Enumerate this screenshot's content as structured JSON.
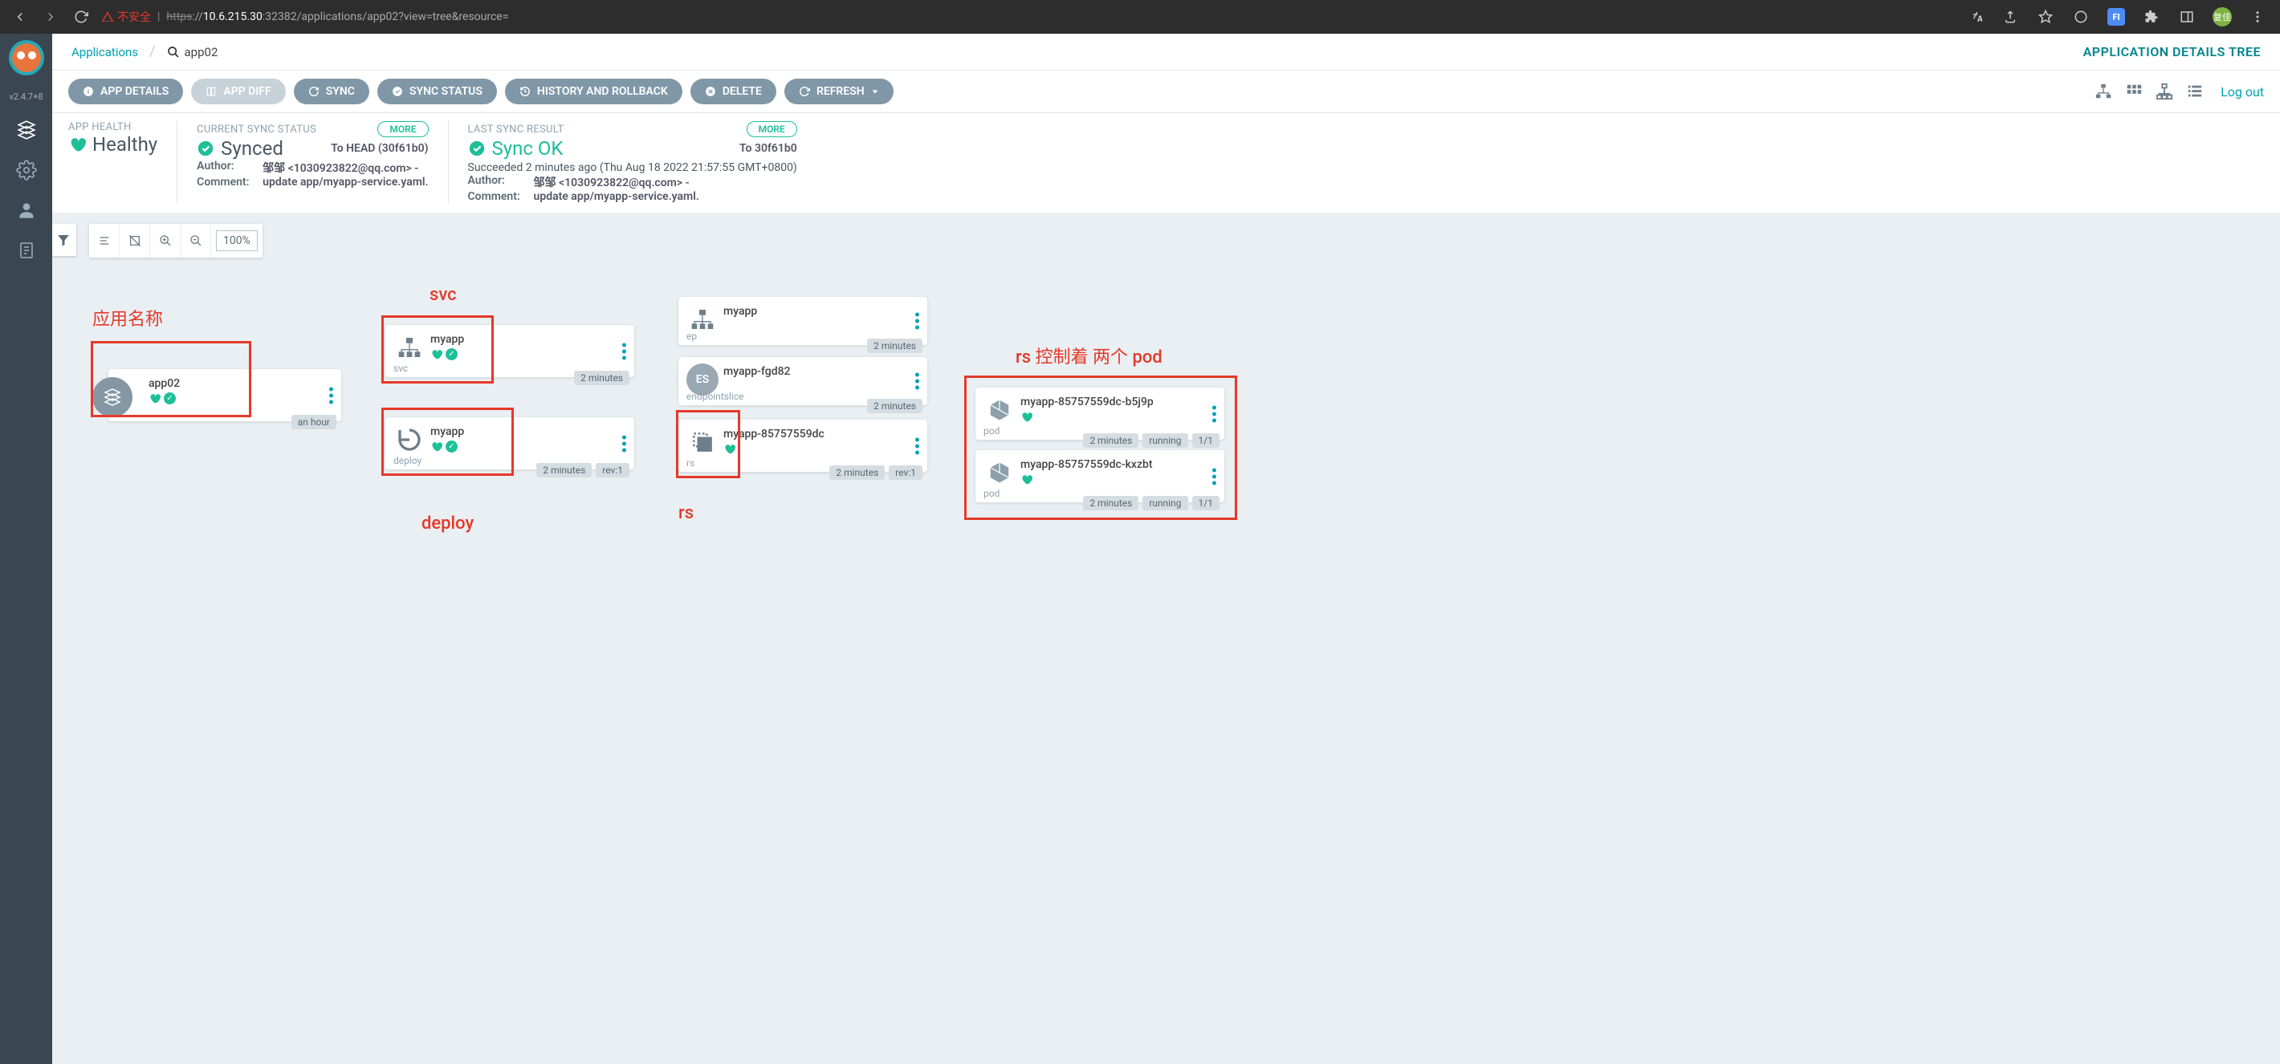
{
  "browser": {
    "insecure_label": "不安全",
    "url_scheme": "https",
    "url_host": "10.6.215.30",
    "url_port": ":32382",
    "url_path": "/applications/app02?view=tree&resource=",
    "avatar": "复佳"
  },
  "sidebar": {
    "version": "v2.4.7+8"
  },
  "breadcrumb": {
    "root": "Applications",
    "current": "app02",
    "title": "APPLICATION DETAILS TREE"
  },
  "toolbar": {
    "app_details": "APP DETAILS",
    "app_diff": "APP DIFF",
    "sync": "SYNC",
    "sync_status": "SYNC STATUS",
    "history": "HISTORY AND ROLLBACK",
    "delete": "DELETE",
    "refresh": "REFRESH",
    "logout": "Log out"
  },
  "status": {
    "health_label": "APP HEALTH",
    "health_value": "Healthy",
    "sync_label": "CURRENT SYNC STATUS",
    "sync_value": "Synced",
    "sync_head": "To HEAD (30f61b0)",
    "more": "MORE",
    "author_label": "Author:",
    "comment_label": "Comment:",
    "author1": "邹邹 <1030923822@qq.com> -",
    "comment1": "update app/myapp-service.yaml.",
    "last_sync_label": "LAST SYNC RESULT",
    "last_sync_value": "Sync OK",
    "last_sync_to": "To 30f61b0",
    "succeeded": "Succeeded 2 minutes ago (Thu Aug 18 2022 21:57:55 GMT+0800)",
    "author2": "邹邹 <1030923822@qq.com> -",
    "comment2": "update app/myapp-service.yaml."
  },
  "zoom": {
    "pct": "100%"
  },
  "annotations": {
    "app_name": "应用名称",
    "svc": "svc",
    "deploy": "deploy",
    "rs": "rs",
    "rs_pod": "rs 控制着 两个 pod"
  },
  "nodes": {
    "root": {
      "name": "app02",
      "age": "an hour"
    },
    "svc": {
      "name": "myapp",
      "kind": "svc",
      "age": "2 minutes"
    },
    "deploy": {
      "name": "myapp",
      "kind": "deploy",
      "age": "2 minutes",
      "rev": "rev:1"
    },
    "ep": {
      "name": "myapp",
      "kind": "ep",
      "age": "2 minutes"
    },
    "es": {
      "name": "myapp-fgd82",
      "kind": "endpointslice",
      "label": "ES",
      "age": "2 minutes"
    },
    "rs": {
      "name": "myapp-85757559dc",
      "kind": "rs",
      "age": "2 minutes",
      "rev": "rev:1"
    },
    "pod1": {
      "name": "myapp-85757559dc-b5j9p",
      "kind": "pod",
      "age": "2 minutes",
      "state": "running",
      "ready": "1/1"
    },
    "pod2": {
      "name": "myapp-85757559dc-kxzbt",
      "kind": "pod",
      "age": "2 minutes",
      "state": "running",
      "ready": "1/1"
    }
  }
}
